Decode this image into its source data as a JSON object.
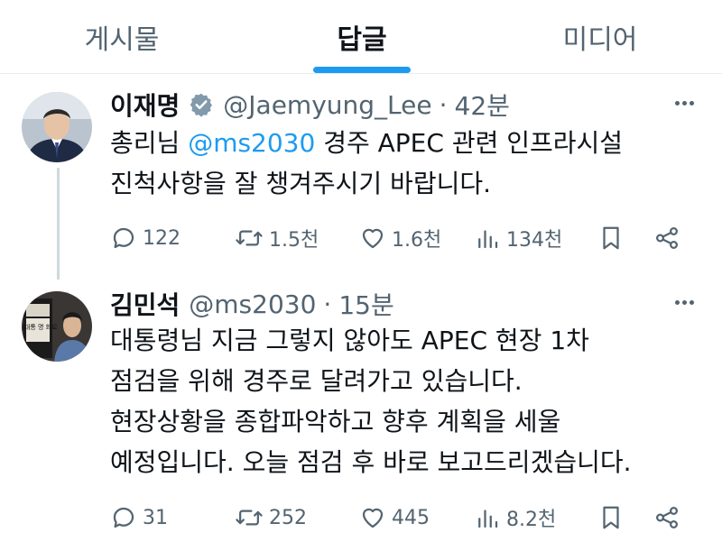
{
  "tabs": [
    {
      "label": "게시물",
      "active": false
    },
    {
      "label": "답글",
      "active": true
    },
    {
      "label": "미디어",
      "active": false
    }
  ],
  "colors": {
    "accent": "#1d9bf0",
    "text": "#0f1419",
    "secondary": "#536471",
    "verified": "#829aab"
  },
  "tweets": [
    {
      "name": "이재명",
      "verified": true,
      "handle": "@Jaemyung_Lee",
      "separator": "·",
      "time": "42분",
      "text_before": "총리님 ",
      "mention": "@ms2030",
      "text_after": " 경주 APEC 관련 인프라시설\n진척사항을 잘 챙겨주시기 바랍니다.",
      "replies": "122",
      "retweets": "1.5천",
      "likes": "1.6천",
      "views": "134천"
    },
    {
      "name": "김민석",
      "verified": false,
      "handle": "@ms2030",
      "separator": "·",
      "time": "15분",
      "text": "대통령님 지금 그렇지 않아도 APEC 현장 1차\n점검을 위해 경주로 달려가고 있습니다.\n현장상황을 종합파악하고 향후 계획을 세울\n예정입니다. 오늘 점검 후 바로 보고드리겠습니다.",
      "avatar_sign_text": "김대통 명 화로",
      "replies": "31",
      "retweets": "252",
      "likes": "445",
      "views": "8.2천"
    }
  ]
}
